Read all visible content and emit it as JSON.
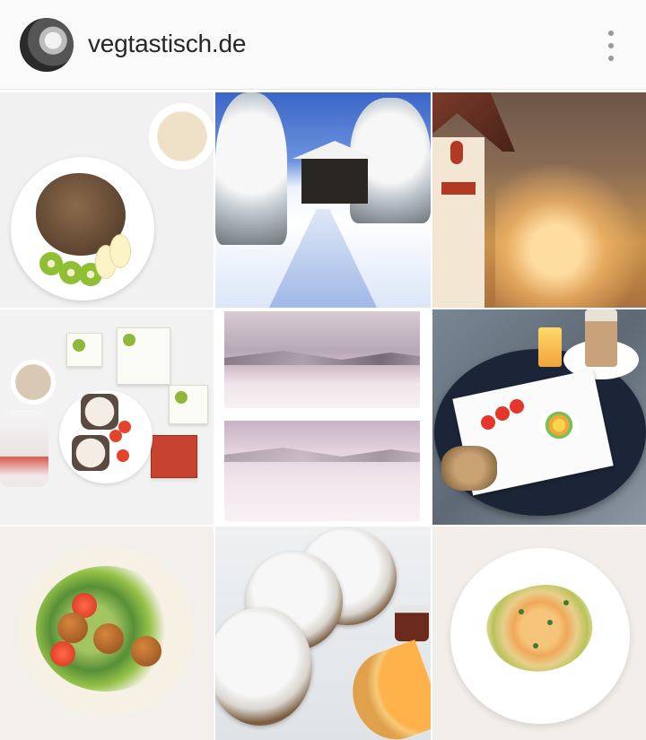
{
  "header": {
    "username": "vegtastisch.de",
    "more_icon": "more-vertical-icon"
  },
  "grid": {
    "posts": [
      {
        "id": 1,
        "subject": "pancake-bowl"
      },
      {
        "id": 2,
        "subject": "snowy-path"
      },
      {
        "id": 3,
        "subject": "hotel-winter"
      },
      {
        "id": 4,
        "subject": "breakfast-spread"
      },
      {
        "id": 5,
        "subject": "snow-landscape-collage"
      },
      {
        "id": 6,
        "subject": "outdoor-breakfast"
      },
      {
        "id": 7,
        "subject": "falafel-wrap"
      },
      {
        "id": 8,
        "subject": "sugar-pancakes"
      },
      {
        "id": 9,
        "subject": "ravioli-plate"
      }
    ]
  },
  "colors": {
    "text_primary": "#262626",
    "icon_gray": "#999999",
    "header_bg": "#fafafa"
  }
}
